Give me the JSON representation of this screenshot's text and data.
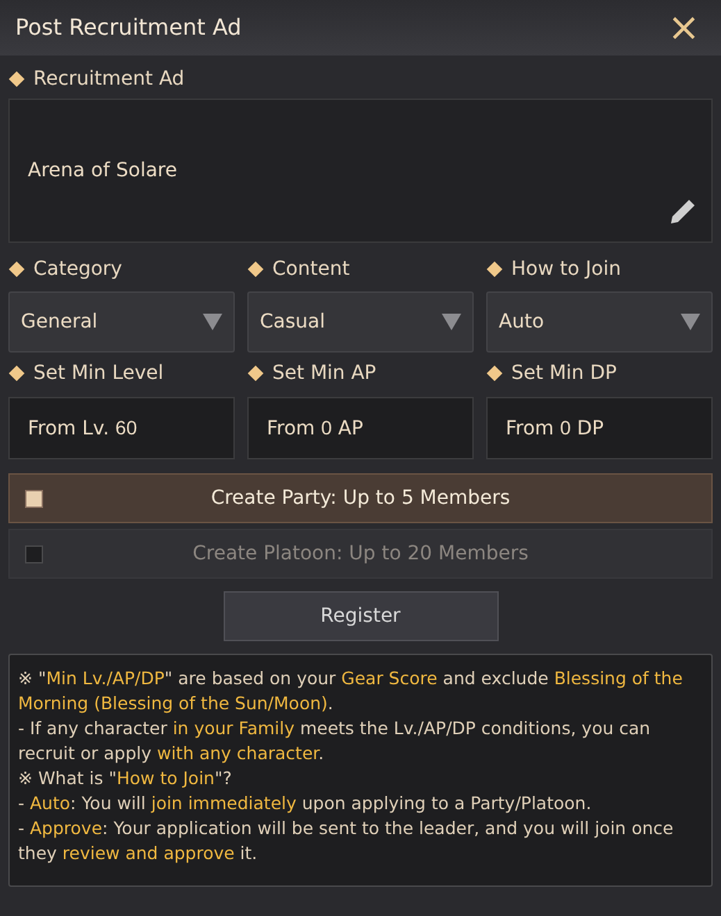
{
  "window": {
    "title": "Post Recruitment Ad",
    "close": "×"
  },
  "ad": {
    "label": "Recruitment Ad",
    "value": "Arena of Solare"
  },
  "dropdowns": [
    {
      "label": "Category",
      "value": "General"
    },
    {
      "label": "Content",
      "value": "Casual"
    },
    {
      "label": "How to Join",
      "value": "Auto"
    }
  ],
  "min_fields": [
    {
      "label": "Set Min Level",
      "prefix": "From Lv.",
      "value": "60"
    },
    {
      "label": "Set Min AP",
      "prefix": "From",
      "value": "0",
      "suffix": "AP"
    },
    {
      "label": "Set Min DP",
      "prefix": "From",
      "value": "0",
      "suffix": "DP"
    }
  ],
  "group_options": [
    {
      "label": "Create Party: Up to 5 Members",
      "selected": true
    },
    {
      "label": "Create Platoon: Up to 20 Members",
      "selected": false
    }
  ],
  "register_button": "Register",
  "notes": [
    "※ \"**Min Lv./AP/DP**\" are based on your **Gear Score** and exclude **Blessing of the Morning (Blessing of the Sun/Moon)**.",
    "- If any character **in your Family** meets the Lv./AP/DP conditions, you can recruit or apply **with any character**.",
    "※ What is \"**How to Join**\"?",
    "- **Auto**: You will **join immediately** upon applying to a Party/Platoon.",
    "- **Approve**: Your application will be sent to the leader, and you will join once they **review and approve** it."
  ]
}
